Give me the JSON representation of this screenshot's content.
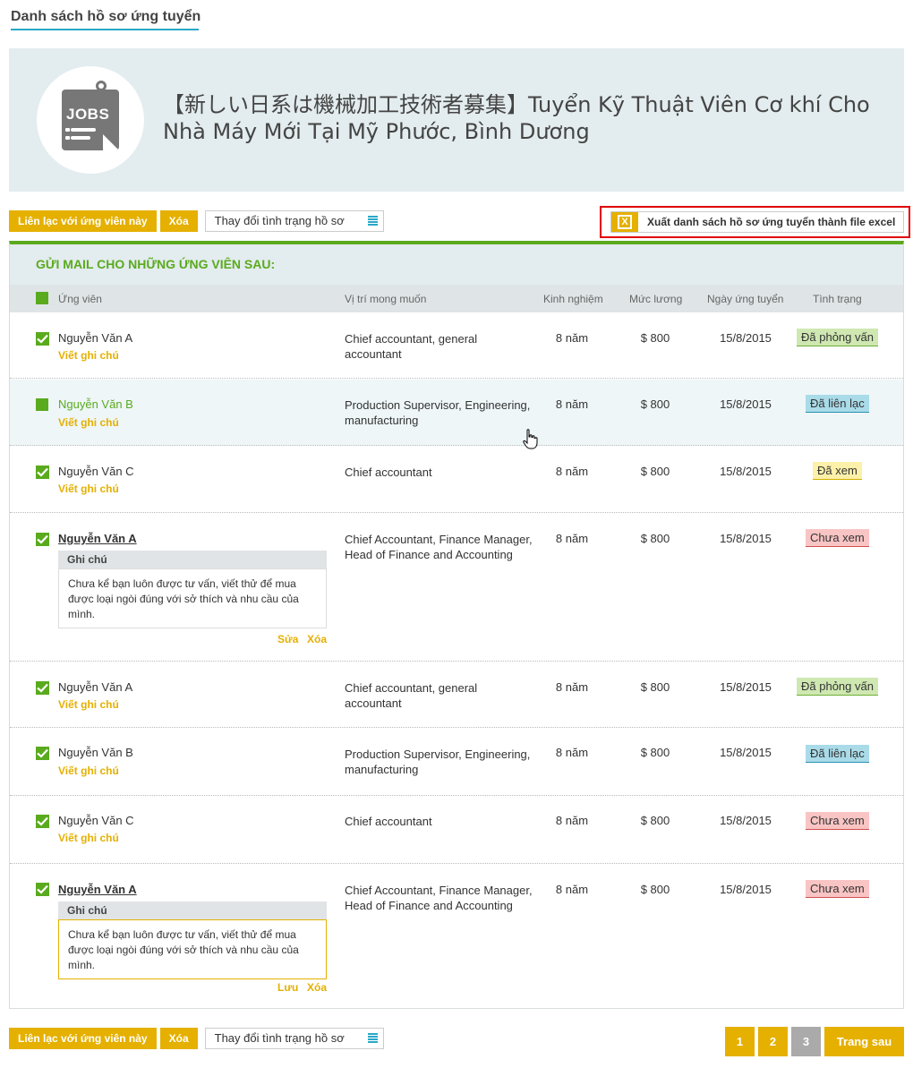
{
  "page": {
    "title": "Danh sách hồ sơ ứng tuyển"
  },
  "job": {
    "icon_text": "JOBS",
    "title": "【新しい日系は機械加工技術者募集】Tuyển Kỹ Thuật Viên Cơ khí Cho Nhà Máy Mới Tại Mỹ Phước, Bình Dương"
  },
  "toolbar": {
    "contact_label": "Liên lạc với ứng viên này",
    "delete_label": "Xóa",
    "status_select_value": "Thay đổi tình trạng hồ sơ",
    "export_label": "Xuất danh sách hồ sơ ứng tuyển thành file excel",
    "export_icon": "X"
  },
  "list": {
    "mail_heading": "GỬI MAIL CHO NHỮNG ỨNG VIÊN SAU:",
    "columns": {
      "candidate": "Ứng viên",
      "position": "Vị trí mong muốn",
      "experience": "Kinh nghiệm",
      "salary": "Mức lương",
      "date": "Ngày ứng tuyển",
      "status": "Tình trạng"
    },
    "rows": [
      {
        "name": "Nguyễn Văn A",
        "note_link": "Viết ghi chú",
        "position": "Chief accountant, general accountant",
        "experience": "8 năm",
        "salary": "$ 800",
        "date": "15/8/2015",
        "status": "Đã phỏng vấn"
      },
      {
        "name": "Nguyễn Văn B",
        "note_link": "Viết ghi chú",
        "position": "Production Supervisor, Engineering, manufacturing",
        "experience": "8 năm",
        "salary": "$ 800",
        "date": "15/8/2015",
        "status": "Đã liên lạc"
      },
      {
        "name": "Nguyễn Văn C",
        "note_link": "Viết ghi chú",
        "position": "Chief accountant",
        "experience": "8 năm",
        "salary": "$ 800",
        "date": "15/8/2015",
        "status": "Đã xem"
      },
      {
        "name": "Nguyễn Văn A",
        "note_title": "Ghi chú",
        "note_text": "Chưa kể bạn luôn được tư vấn, viết thử để mua được loại ngòi đúng với sở thích và nhu cầu của mình.",
        "note_edit": "Sửa",
        "note_delete": "Xóa",
        "position": "Chief Accountant, Finance Manager, Head of Finance and Accounting",
        "experience": "8 năm",
        "salary": "$ 800",
        "date": "15/8/2015",
        "status": "Chưa xem"
      },
      {
        "name": "Nguyễn Văn A",
        "note_link": "Viết ghi chú",
        "position": "Chief accountant, general accountant",
        "experience": "8 năm",
        "salary": "$ 800",
        "date": "15/8/2015",
        "status": "Đã phỏng vấn"
      },
      {
        "name": "Nguyễn Văn B",
        "note_link": "Viết ghi chú",
        "position": "Production Supervisor, Engineering, manufacturing",
        "experience": "8 năm",
        "salary": "$ 800",
        "date": "15/8/2015",
        "status": "Đã liên lạc"
      },
      {
        "name": "Nguyễn Văn C",
        "note_link": "Viết ghi chú",
        "position": "Chief accountant",
        "experience": "8 năm",
        "salary": "$ 800",
        "date": "15/8/2015",
        "status": "Chưa xem"
      },
      {
        "name": "Nguyễn Văn A",
        "note_title": "Ghi chú",
        "note_text": "Chưa kể bạn luôn được tư vấn, viết thử để mua được loại ngòi đúng với sở thích và nhu cầu của mình.",
        "note_save": "Lưu",
        "note_delete": "Xóa",
        "position": "Chief Accountant, Finance Manager, Head of Finance and Accounting",
        "experience": "8 năm",
        "salary": "$ 800",
        "date": "15/8/2015",
        "status": "Chưa xem"
      }
    ]
  },
  "pagination": {
    "pages": [
      "1",
      "2",
      "3"
    ],
    "next_label": "Trang sau"
  },
  "colors": {
    "accent_yellow": "#e5b000",
    "accent_green": "#5aaa1e",
    "accent_blue": "#29a8c8",
    "highlight_red": "#e00000"
  },
  "icons": {
    "job": "jobs-icon",
    "excel": "excel-icon",
    "list": "list-icon",
    "check": "checkmark-icon",
    "cursor": "hand-cursor-icon"
  }
}
